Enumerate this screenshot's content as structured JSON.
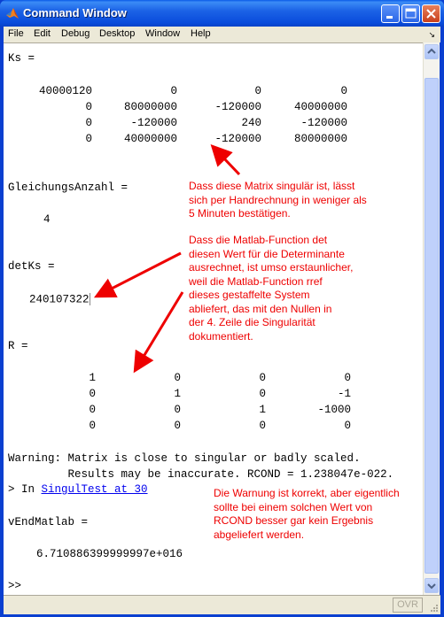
{
  "window": {
    "title": "Command Window",
    "icon": "matlab-logo-icon",
    "controls": [
      "minimize",
      "maximize",
      "close"
    ]
  },
  "menubar": {
    "items": [
      {
        "label": "File",
        "mnemonic": "F"
      },
      {
        "label": "Edit",
        "mnemonic": "E"
      },
      {
        "label": "Debug",
        "mnemonic": "b"
      },
      {
        "label": "Desktop",
        "mnemonic": "D"
      },
      {
        "label": "Window",
        "mnemonic": "W"
      },
      {
        "label": "Help",
        "mnemonic": "H"
      }
    ]
  },
  "console": {
    "ks_label": "Ks =",
    "ks_matrix": [
      [
        "40000120",
        "0",
        "0",
        "0"
      ],
      [
        "0",
        "80000000",
        "-120000",
        "40000000"
      ],
      [
        "0",
        "-120000",
        "240",
        "-120000"
      ],
      [
        "0",
        "40000000",
        "-120000",
        "80000000"
      ]
    ],
    "gleichungs_label": "GleichungsAnzahl =",
    "gleichungs_value": "4",
    "detks_label": "detKs =",
    "detks_value": "240107322",
    "r_label": "R =",
    "r_matrix": [
      [
        "1",
        "0",
        "0",
        "0"
      ],
      [
        "0",
        "1",
        "0",
        "-1"
      ],
      [
        "0",
        "0",
        "1",
        "-1000"
      ],
      [
        "0",
        "0",
        "0",
        "0"
      ]
    ],
    "warning_line1": "Warning: Matrix is close to singular or badly scaled.",
    "warning_line2": "         Results may be inaccurate. RCOND = 1.238047e-022.",
    "in_prefix": "> In ",
    "in_link": "SingulTest at 30",
    "vend_label": "vEndMatlab =",
    "vend_value": "6.710886399999997e+016",
    "prompt": ">>"
  },
  "annotations": {
    "note1": "Dass diese Matrix singulär ist, lässt\nsich per Handrechnung in weniger als\n5 Minuten bestätigen.",
    "note2": "Dass die Matlab-Function det\ndiesen Wert für die Determinante\nausrechnet, ist umso erstaunlicher,\nweil die Matlab-Function rref\ndieses gestaffelte System\nabliefert, das mit den Nullen in\nder 4. Zeile die Singularität\ndokumentiert.",
    "note3": "Die Warnung ist korrekt, aber eigentlich\nsollte bei einem solchen Wert von\nRCOND besser gar kein Ergebnis\nabgeliefert werden.",
    "color": "#ee0000"
  },
  "statusbar": {
    "ovr": "OVR"
  }
}
